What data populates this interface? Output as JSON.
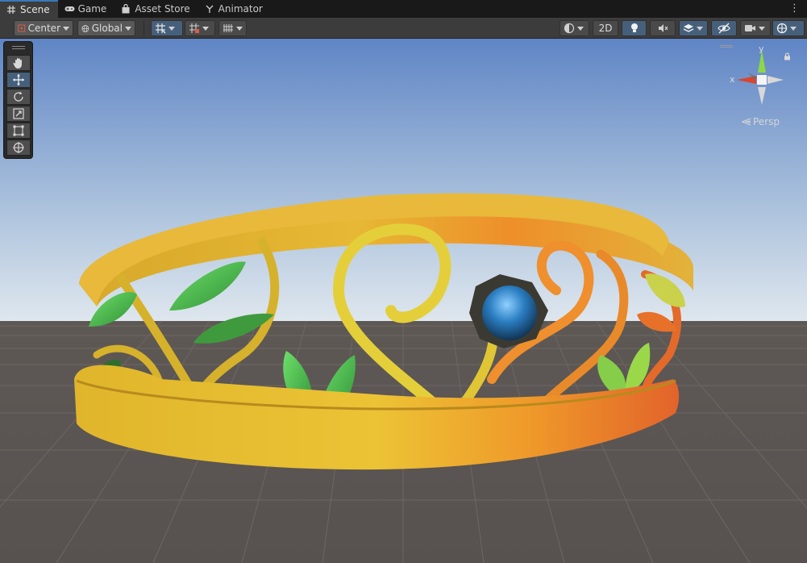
{
  "tabs": [
    {
      "label": "Scene",
      "icon": "grid-icon",
      "active": true
    },
    {
      "label": "Game",
      "icon": "gamepad-icon",
      "active": false
    },
    {
      "label": "Asset Store",
      "icon": "store-bag-icon",
      "active": false
    },
    {
      "label": "Animator",
      "icon": "animator-icon",
      "active": false
    }
  ],
  "toolbar": {
    "pivot_mode": "Center",
    "pivot_rotation": "Global",
    "view_2d": "2D"
  },
  "tools": [
    "view-tool",
    "move-tool",
    "rotate-tool",
    "scale-tool",
    "rect-tool",
    "transform-tool"
  ],
  "gizmo": {
    "axis_x": "x",
    "axis_y": "y",
    "projection": "Persp"
  },
  "colors": {
    "accent": "#3a79bb",
    "toolbar_bg": "#3c3c3c",
    "button_bg": "#585858",
    "button_on": "#46607c",
    "axis_x": "#d9452d",
    "axis_y": "#8dd64a",
    "axis_z": "#d8d8d8"
  }
}
